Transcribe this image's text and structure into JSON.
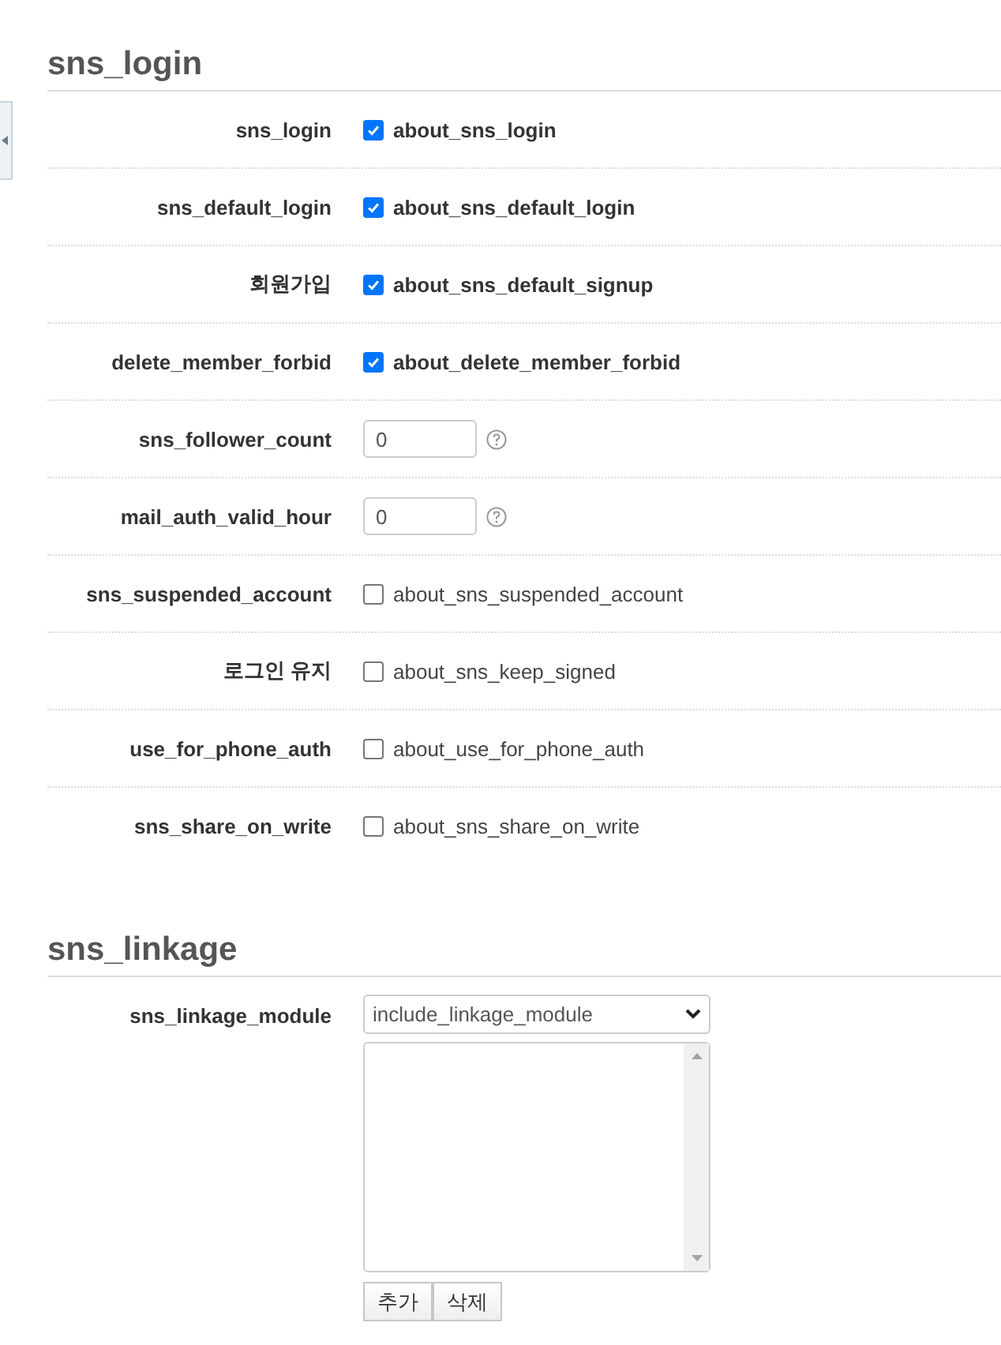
{
  "sections": [
    {
      "title": "sns_login",
      "rows": [
        {
          "kind": "checkbox",
          "label": "sns_login",
          "checked": true,
          "text": "about_sns_login"
        },
        {
          "kind": "checkbox",
          "label": "sns_default_login",
          "checked": true,
          "text": "about_sns_default_login"
        },
        {
          "kind": "checkbox",
          "label": "회원가입",
          "checked": true,
          "text": "about_sns_default_signup"
        },
        {
          "kind": "checkbox",
          "label": "delete_member_forbid",
          "checked": true,
          "text": "about_delete_member_forbid"
        },
        {
          "kind": "number",
          "label": "sns_follower_count",
          "value": "0"
        },
        {
          "kind": "number",
          "label": "mail_auth_valid_hour",
          "value": "0"
        },
        {
          "kind": "checkbox",
          "label": "sns_suspended_account",
          "checked": false,
          "text": "about_sns_suspended_account"
        },
        {
          "kind": "checkbox",
          "label": "로그인 유지",
          "checked": false,
          "text": "about_sns_keep_signed"
        },
        {
          "kind": "checkbox",
          "label": "use_for_phone_auth",
          "checked": false,
          "text": "about_use_for_phone_auth"
        },
        {
          "kind": "checkbox",
          "label": "sns_share_on_write",
          "checked": false,
          "text": "about_sns_share_on_write"
        }
      ]
    },
    {
      "title": "sns_linkage",
      "rows": [
        {
          "kind": "module",
          "label": "sns_linkage_module",
          "value": "include_linkage_module",
          "buttons": [
            "추가",
            "삭제"
          ]
        }
      ]
    }
  ]
}
